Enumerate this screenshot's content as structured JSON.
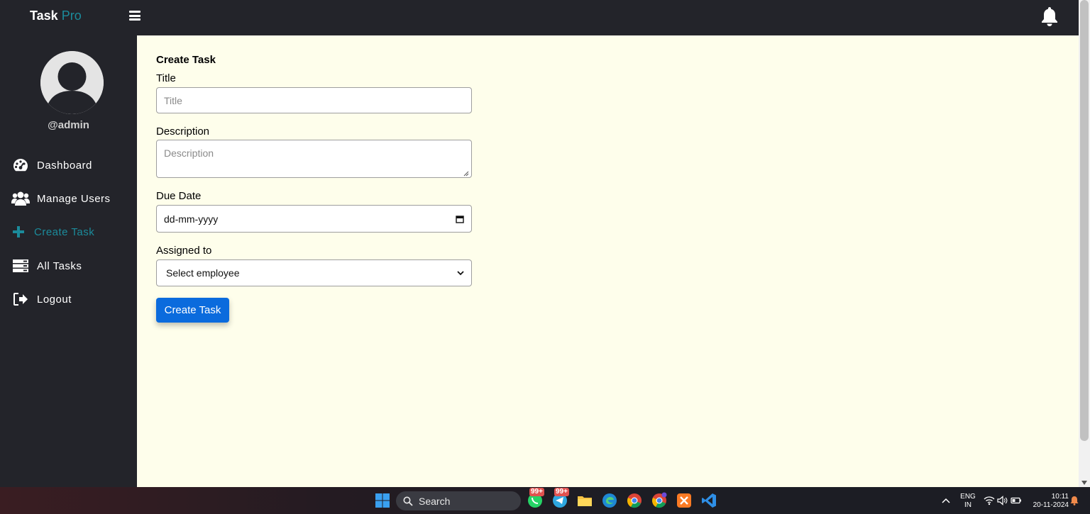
{
  "app": {
    "brand_main": "Task",
    "brand_accent": "Pro"
  },
  "sidebar": {
    "username": "@admin",
    "items": [
      {
        "label": "Dashboard",
        "icon": "palette-icon",
        "active": false
      },
      {
        "label": "Manage Users",
        "icon": "users-icon",
        "active": true
      },
      {
        "label": "Create Task",
        "icon": "plus-icon",
        "active": true
      },
      {
        "label": "All Tasks",
        "icon": "server-list-icon",
        "active": false
      },
      {
        "label": "Logout",
        "icon": "sign-out-icon",
        "active": false
      }
    ]
  },
  "form": {
    "heading": "Create Task",
    "title_label": "Title",
    "title_placeholder": "Title",
    "description_label": "Description",
    "description_placeholder": "Description",
    "due_date_label": "Due Date",
    "due_date_value": "dd-mm-yyyy",
    "assigned_label": "Assigned to",
    "assigned_value": "Select employee",
    "submit_label": "Create Task"
  },
  "taskbar": {
    "search_label": "Search",
    "whatsapp_badge": "99+",
    "telegram_badge": "99+",
    "lang_top": "ENG",
    "lang_bottom": "IN",
    "time": "10:11",
    "date": "20-11-2024"
  },
  "colors": {
    "accent": "#1b8b9b",
    "button": "#0b6bdd",
    "sidebar_bg": "#23242a",
    "main_bg": "#fefeeb"
  }
}
